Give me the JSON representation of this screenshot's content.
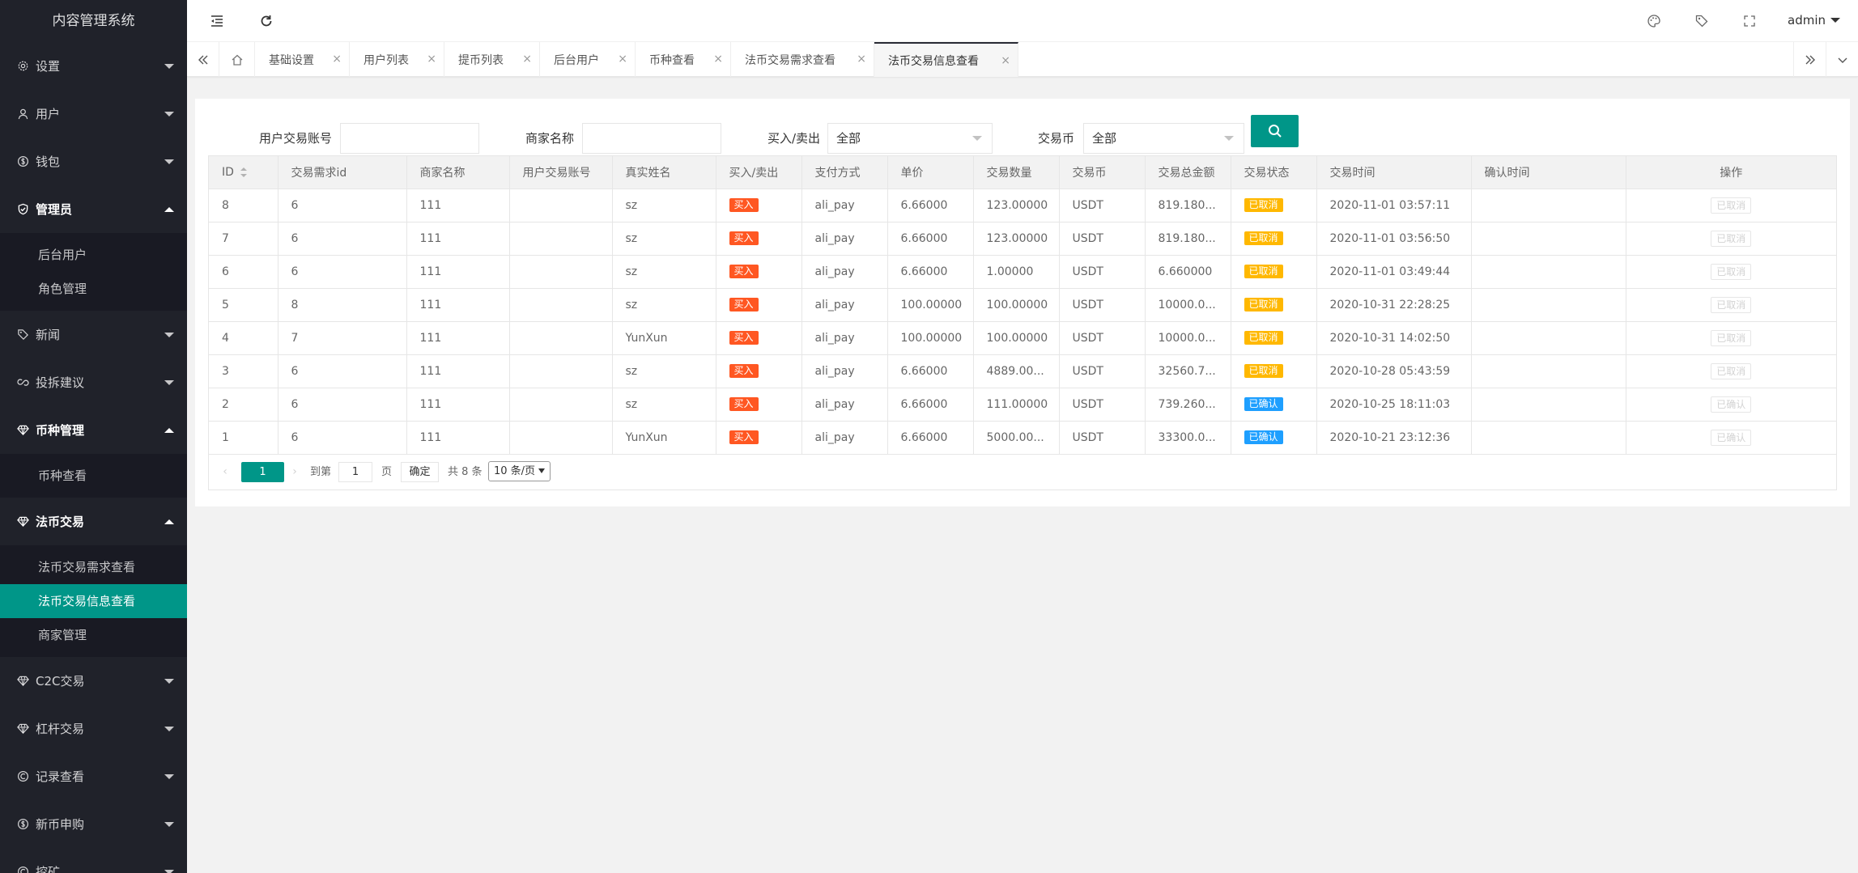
{
  "app": {
    "title": "内容管理系统"
  },
  "sidebar": {
    "groups": [
      {
        "label": "设置",
        "icon": "gear-icon",
        "open": false,
        "children": []
      },
      {
        "label": "用户",
        "icon": "user-icon",
        "open": false,
        "children": []
      },
      {
        "label": "钱包",
        "icon": "dollar-icon",
        "open": false,
        "children": []
      },
      {
        "label": "管理员",
        "icon": "shield-check-icon",
        "open": true,
        "children": [
          {
            "label": "后台用户",
            "active": false
          },
          {
            "label": "角色管理",
            "active": false
          }
        ]
      },
      {
        "label": "新闻",
        "icon": "tag-icon",
        "open": false,
        "children": []
      },
      {
        "label": "投拆建议",
        "icon": "link-icon",
        "open": false,
        "children": []
      },
      {
        "label": "币种管理",
        "icon": "diamond-icon",
        "open": true,
        "children": [
          {
            "label": "币种查看",
            "active": false
          }
        ]
      },
      {
        "label": "法币交易",
        "icon": "diamond-icon",
        "open": true,
        "children": [
          {
            "label": "法币交易需求查看",
            "active": false
          },
          {
            "label": "法币交易信息查看",
            "active": true
          },
          {
            "label": "商家管理",
            "active": false
          }
        ]
      },
      {
        "label": "C2C交易",
        "icon": "diamond-icon",
        "open": false,
        "children": []
      },
      {
        "label": "杠杆交易",
        "icon": "diamond-icon",
        "open": false,
        "children": []
      },
      {
        "label": "记录查看",
        "icon": "circle-c-icon",
        "open": false,
        "children": []
      },
      {
        "label": "新币申购",
        "icon": "dollar-icon",
        "open": false,
        "children": []
      },
      {
        "label": "挖矿",
        "icon": "circle-c-icon",
        "open": false,
        "children": []
      }
    ]
  },
  "header": {
    "left_icons": [
      "menu-collapse-icon",
      "refresh-icon"
    ],
    "right_icons": [
      "theme-palette-icon",
      "tag-icon",
      "fullscreen-icon"
    ],
    "user": "admin"
  },
  "tabs": {
    "items": [
      {
        "label": "基础设置",
        "active": false
      },
      {
        "label": "用户列表",
        "active": false
      },
      {
        "label": "提币列表",
        "active": false
      },
      {
        "label": "后台用户",
        "active": false
      },
      {
        "label": "币种查看",
        "active": false
      },
      {
        "label": "法币交易需求查看",
        "active": false
      },
      {
        "label": "法币交易信息查看",
        "active": true
      }
    ],
    "close_glyph": "×"
  },
  "filters": {
    "account_label": "用户交易账号",
    "account_value": "",
    "merchant_label": "商家名称",
    "merchant_value": "",
    "direction_label": "买入/卖出",
    "direction_value": "全部",
    "currency_label": "交易币",
    "currency_value": "全部"
  },
  "table": {
    "columns": [
      "ID",
      "交易需求id",
      "商家名称",
      "用户交易账号",
      "真实姓名",
      "买入/卖出",
      "支付方式",
      "单价",
      "交易数量",
      "交易币",
      "交易总金额",
      "交易状态",
      "交易时间",
      "确认时间",
      "操作"
    ],
    "rows": [
      {
        "id": "8",
        "demand_id": "6",
        "merchant": "111",
        "account": "",
        "name": "sz",
        "direction": "买入",
        "pay": "ali_pay",
        "price": "6.66000",
        "qty": "123.00000",
        "coin": "USDT",
        "total": "819.180...",
        "status": "已取消",
        "status_type": "cancel",
        "time": "2020-11-01 03:57:11",
        "confirm_time": "",
        "op": "已取消"
      },
      {
        "id": "7",
        "demand_id": "6",
        "merchant": "111",
        "account": "",
        "name": "sz",
        "direction": "买入",
        "pay": "ali_pay",
        "price": "6.66000",
        "qty": "123.00000",
        "coin": "USDT",
        "total": "819.180...",
        "status": "已取消",
        "status_type": "cancel",
        "time": "2020-11-01 03:56:50",
        "confirm_time": "",
        "op": "已取消"
      },
      {
        "id": "6",
        "demand_id": "6",
        "merchant": "111",
        "account": "",
        "name": "sz",
        "direction": "买入",
        "pay": "ali_pay",
        "price": "6.66000",
        "qty": "1.00000",
        "coin": "USDT",
        "total": "6.660000",
        "status": "已取消",
        "status_type": "cancel",
        "time": "2020-11-01 03:49:44",
        "confirm_time": "",
        "op": "已取消"
      },
      {
        "id": "5",
        "demand_id": "8",
        "merchant": "111",
        "account": "",
        "name": "sz",
        "direction": "买入",
        "pay": "ali_pay",
        "price": "100.00000",
        "qty": "100.00000",
        "coin": "USDT",
        "total": "10000.0...",
        "status": "已取消",
        "status_type": "cancel",
        "time": "2020-10-31 22:28:25",
        "confirm_time": "",
        "op": "已取消"
      },
      {
        "id": "4",
        "demand_id": "7",
        "merchant": "111",
        "account": "",
        "name": "YunXun",
        "direction": "买入",
        "pay": "ali_pay",
        "price": "100.00000",
        "qty": "100.00000",
        "coin": "USDT",
        "total": "10000.0...",
        "status": "已取消",
        "status_type": "cancel",
        "time": "2020-10-31 14:02:50",
        "confirm_time": "",
        "op": "已取消"
      },
      {
        "id": "3",
        "demand_id": "6",
        "merchant": "111",
        "account": "",
        "name": "sz",
        "direction": "买入",
        "pay": "ali_pay",
        "price": "6.66000",
        "qty": "4889.00...",
        "coin": "USDT",
        "total": "32560.7...",
        "status": "已取消",
        "status_type": "cancel",
        "time": "2020-10-28 05:43:59",
        "confirm_time": "",
        "op": "已取消"
      },
      {
        "id": "2",
        "demand_id": "6",
        "merchant": "111",
        "account": "",
        "name": "sz",
        "direction": "买入",
        "pay": "ali_pay",
        "price": "6.66000",
        "qty": "111.00000",
        "coin": "USDT",
        "total": "739.260...",
        "status": "已确认",
        "status_type": "confirm",
        "time": "2020-10-25 18:11:03",
        "confirm_time": "",
        "op": "已确认"
      },
      {
        "id": "1",
        "demand_id": "6",
        "merchant": "111",
        "account": "",
        "name": "YunXun",
        "direction": "买入",
        "pay": "ali_pay",
        "price": "6.66000",
        "qty": "5000.00...",
        "coin": "USDT",
        "total": "33300.0...",
        "status": "已确认",
        "status_type": "confirm",
        "time": "2020-10-21 23:12:36",
        "confirm_time": "",
        "op": "已确认"
      }
    ]
  },
  "pagination": {
    "prev": "‹",
    "current_page": "1",
    "next": "›",
    "goto_label": "到第",
    "goto_value": "1",
    "page_unit": "页",
    "confirm_label": "确定",
    "total_text": "共 8 条",
    "limit_value": "10 条/页"
  },
  "colors": {
    "accent": "#009688",
    "sidebar_bg": "#20222a",
    "buy_badge": "#ff5722",
    "cancel_badge": "#ffb800",
    "confirm_badge": "#1e9fff"
  }
}
